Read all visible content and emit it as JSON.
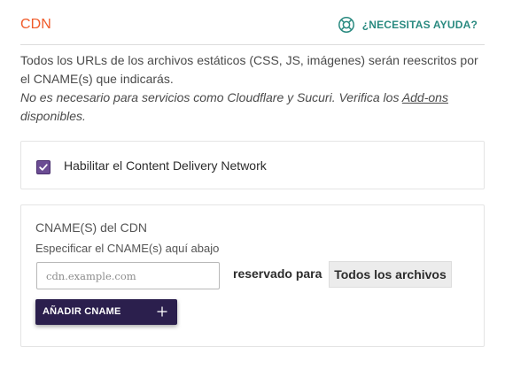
{
  "header": {
    "title": "CDN",
    "help_label": "¿NECESITAS AYUDA?",
    "help_icon": "lifebuoy-icon"
  },
  "description": {
    "main": "Todos los URLs de los archivos estáticos (CSS, JS, imágenes) serán reescritos por el CNAME(s) que indicarás.",
    "note_prefix": "No es necesario para servicios como Cloudflare y Sucuri. Verifica los ",
    "note_link": "Add-ons",
    "note_suffix": " disponibles."
  },
  "enable": {
    "label": "Habilitar el Content Delivery Network",
    "checked": true
  },
  "cname": {
    "title": "CNAME(S) del CDN",
    "description": "Especificar el CNAME(s) aquí abajo",
    "input_placeholder": "cdn.example.com",
    "input_value": "",
    "reserved_label": "reservado para",
    "files_option": "Todos los archivos",
    "add_button_label": "AÑADIR CNAME"
  },
  "colors": {
    "title_accent": "#f05a28",
    "help_accent": "#2a8a80",
    "checkbox": "#6b4c93",
    "button_bg": "#2b1f4d"
  }
}
